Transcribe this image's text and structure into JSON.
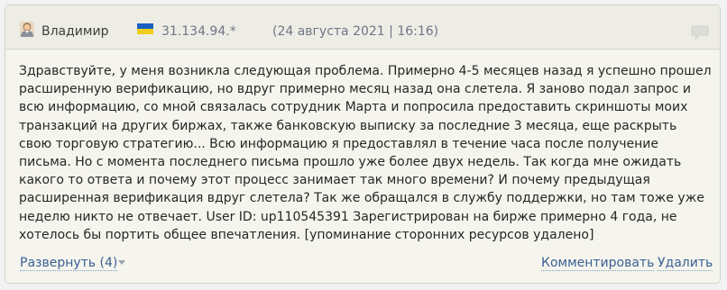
{
  "header": {
    "username": "Владимир",
    "ip": "31.134.94.*",
    "date": "(24 августа 2021 | 16:16)"
  },
  "body": {
    "text": "Здравствуйте, у меня возникла следующая проблема. Примерно 4-5 месяцев назад я успешно прошел расширенную верификацию, но вдруг примерно месяц назад она слетела. Я заново подал запрос и всю информацию, со мной связалась сотрудник Марта и попросила предоставить скриншоты моих транзакций на других биржах, также банковскую выписку за последние 3 месяца, еще раскрыть свою торговую стратегию... Всю информацию я предоставлял в течение часа после получение письма. Но с момента последнего письма прошло уже более двух недель. Так когда мне ожидать какого то ответа и почему этот процесс занимает так много времени? И почему предыдущая расширенная верификация вдруг слетела? Так же обращался в службу поддержки, но там тоже уже неделю никто не отвечает. User ID: up110545391 Зарегистрирован на бирже примерно 4 года, не хотелось бы портить общее впечатления. [упоминание сторонних ресурсов удалено]"
  },
  "footer": {
    "expand_label": "Развернуть (4)",
    "comment_label": "Комментировать",
    "delete_label": "Удалить"
  },
  "icons": {
    "user": "user-avatar-icon",
    "flag": "ukraine-flag-icon",
    "comment": "speech-bubble-icon",
    "expand": "chevron-down-icon"
  },
  "colors": {
    "link": "#3a5f93",
    "meta": "#6e7585",
    "flag_blue": "#1a5fc2",
    "flag_yellow": "#f2cd1b"
  }
}
